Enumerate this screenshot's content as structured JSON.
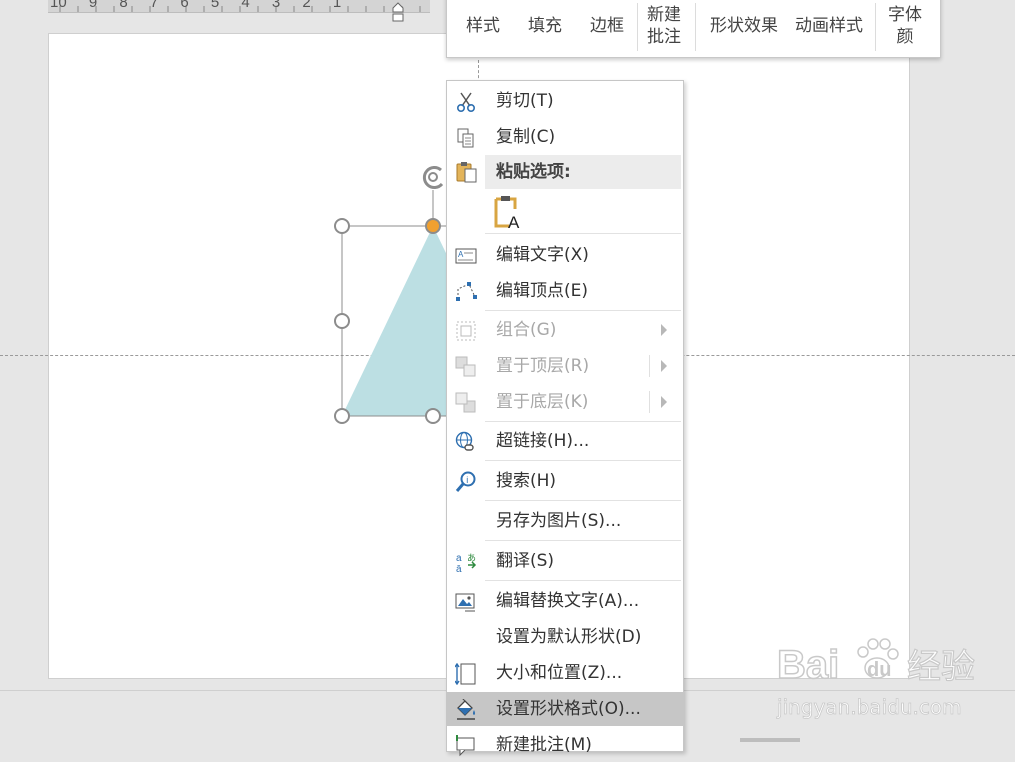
{
  "ruler": {
    "numbers": "10 9 8 7 6 5 4 3 2 1"
  },
  "mini_toolbar": {
    "style": "样式",
    "fill": "填充",
    "border": "边框",
    "new_comment": "新建\n批注",
    "shape_effects": "形状效果",
    "animation_style": "动画样式",
    "font_color": "字体\n颜"
  },
  "context_menu": {
    "cut": "剪切(T)",
    "copy": "复制(C)",
    "paste_options": "粘贴选项:",
    "edit_text": "编辑文字(X)",
    "edit_points": "编辑顶点(E)",
    "group": "组合(G)",
    "bring_to_front": "置于顶层(R)",
    "send_to_back": "置于底层(K)",
    "hyperlink": "超链接(H)...",
    "search": "搜索(H)",
    "save_as_picture": "另存为图片(S)...",
    "translate": "翻译(S)",
    "edit_alt_text": "编辑替换文字(A)...",
    "set_default_shape": "设置为默认形状(D)",
    "size_position": "大小和位置(Z)...",
    "format_shape": "设置形状格式(O)...",
    "new_comment": "新建批注(M)"
  },
  "watermark": {
    "brand": "Bai",
    "brand2": "经验",
    "url": "jingyan.baidu.com"
  },
  "colors": {
    "shape_fill": "#bcdfe3",
    "handle_orange": "#f0a030",
    "highlight": "#c6c6c6",
    "font_color_bar": "#c00000"
  }
}
